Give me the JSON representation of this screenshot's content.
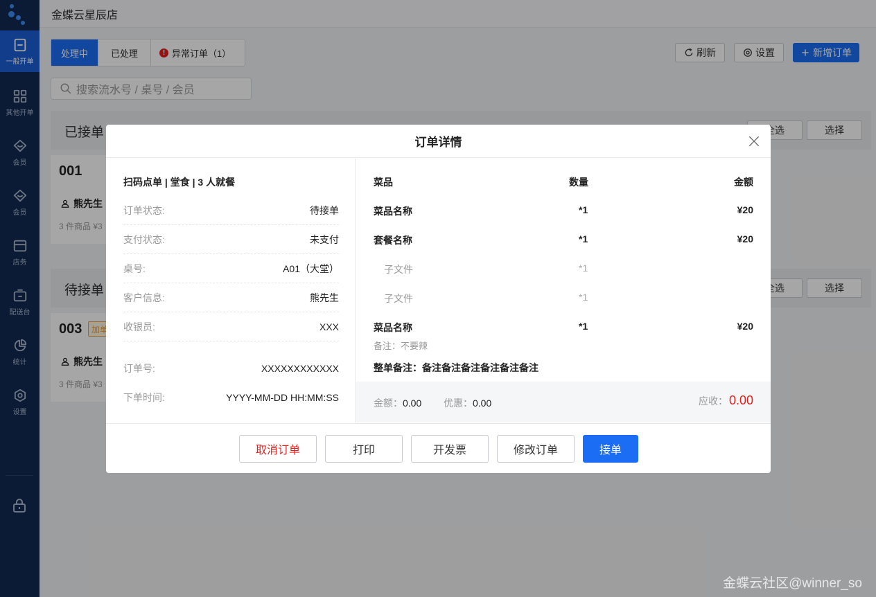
{
  "store_name": "金蝶云星辰店",
  "sidebar": {
    "items": [
      {
        "label": "一般开单",
        "icon": "order-icon"
      },
      {
        "label": "其他开单",
        "icon": "grid-icon"
      },
      {
        "label": "会员",
        "icon": "diamond-icon"
      },
      {
        "label": "会员",
        "icon": "diamond-icon"
      },
      {
        "label": "店务",
        "icon": "store-icon"
      },
      {
        "label": "配送台",
        "icon": "delivery-icon"
      },
      {
        "label": "统计",
        "icon": "pie-chart-icon"
      },
      {
        "label": "设置",
        "icon": "gear-icon"
      }
    ]
  },
  "tabs": {
    "processing": "处理中",
    "processed": "已处理",
    "abnormal": "异常订单（1）",
    "abnormal_mark": "!"
  },
  "toolbar": {
    "refresh": "刷新",
    "settings": "设置",
    "new_order": "新增订单"
  },
  "search": {
    "placeholder": "搜索流水号 / 桌号 / 会员"
  },
  "sections": [
    {
      "title": "已接单",
      "select_all": "全选",
      "select": "选择",
      "card": {
        "no": "001",
        "customer": "熊先生",
        "meta": "3 件商品 ¥3"
      }
    },
    {
      "title": "待接单",
      "select_all": "全选",
      "select": "选择",
      "card": {
        "no": "003",
        "tag": "加单",
        "customer": "熊先生",
        "meta": "3 件商品 ¥3"
      }
    }
  ],
  "modal": {
    "title": "订单详情",
    "order_type": "扫码点单 | 堂食 | 3 人就餐",
    "info": [
      {
        "label": "订单状态:",
        "value": "待接单"
      },
      {
        "label": "支付状态:",
        "value": "未支付"
      },
      {
        "label": "桌号:",
        "value": "A01（大堂）"
      },
      {
        "label": "客户信息:",
        "value": "熊先生"
      },
      {
        "label": "收银员:",
        "value": "XXX"
      },
      {
        "label": "订单号:",
        "value": "XXXXXXXXXXXX"
      },
      {
        "label": "下单时间:",
        "value": "YYYY-MM-DD HH:MM:SS"
      }
    ],
    "columns": {
      "dish": "菜品",
      "qty": "数量",
      "amount": "金额"
    },
    "items": [
      {
        "name": "菜品名称",
        "qty": "*1",
        "amount": "¥20",
        "sub": false
      },
      {
        "name": "套餐名称",
        "qty": "*1",
        "amount": "¥20",
        "sub": false
      },
      {
        "name": "子文件",
        "qty": "*1",
        "amount": "",
        "sub": true
      },
      {
        "name": "子文件",
        "qty": "*1",
        "amount": "",
        "sub": true
      },
      {
        "name": "菜品名称",
        "qty": "*1",
        "amount": "¥20",
        "sub": false
      }
    ],
    "item_note": "备注：不要辣",
    "overall_note": "整单备注：备注备注备注备注备注备注",
    "summary": {
      "amount_label": "金额：",
      "amount": "0.00",
      "discount_label": "优惠：",
      "discount": "0.00",
      "due_label": "应收：",
      "due": "0.00"
    },
    "buttons": {
      "cancel": "取消订单",
      "print": "打印",
      "invoice": "开发票",
      "modify": "修改订单",
      "accept": "接单"
    }
  },
  "credit": "金蝶云社区@winner_so"
}
